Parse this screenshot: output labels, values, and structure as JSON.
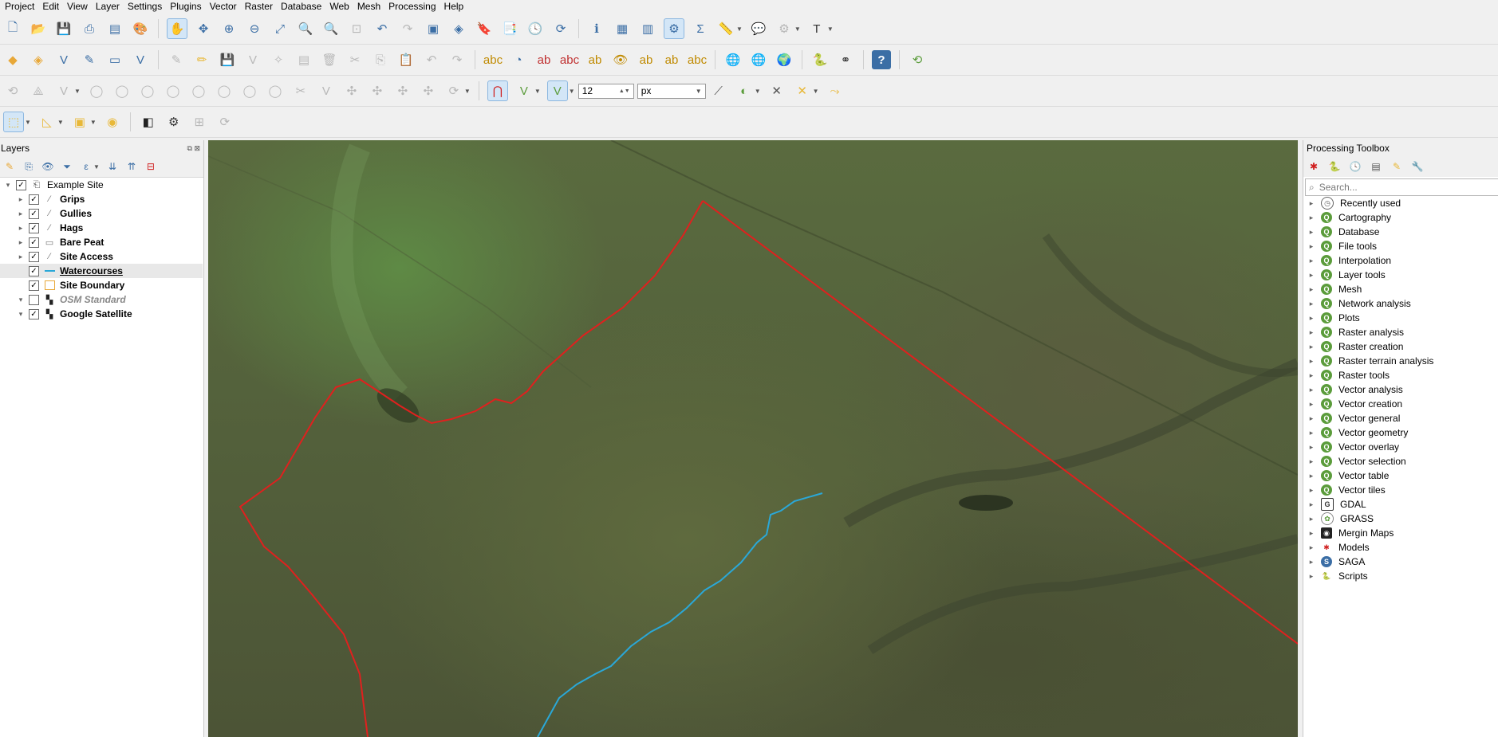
{
  "menubar": [
    "Project",
    "Edit",
    "View",
    "Layer",
    "Settings",
    "Plugins",
    "Vector",
    "Raster",
    "Database",
    "Web",
    "Mesh",
    "Processing",
    "Help"
  ],
  "digitizing": {
    "tolerance_value": "12",
    "tolerance_unit": "px"
  },
  "layers_panel": {
    "title": "Layers",
    "items": [
      {
        "name": "Example Site",
        "checked": true,
        "expander": "▾",
        "symbol": "group-icon",
        "style": "normal"
      },
      {
        "name": "Grips",
        "checked": true,
        "expander": "▸",
        "symbol": "line-layer-icon",
        "style": "bold"
      },
      {
        "name": "Gullies",
        "checked": true,
        "expander": "▸",
        "symbol": "line-layer-icon",
        "style": "bold"
      },
      {
        "name": "Hags",
        "checked": true,
        "expander": "▸",
        "symbol": "line-layer-icon",
        "style": "bold"
      },
      {
        "name": "Bare Peat",
        "checked": true,
        "expander": "▸",
        "symbol": "polygon-layer-icon",
        "style": "bold"
      },
      {
        "name": "Site Access",
        "checked": true,
        "expander": "▸",
        "symbol": "line-layer-icon",
        "style": "bold"
      },
      {
        "name": "Watercourses",
        "checked": true,
        "expander": "",
        "symbol": "blue-line-icon",
        "style": "underline"
      },
      {
        "name": "Site Boundary",
        "checked": true,
        "expander": "",
        "symbol": "polygon-outline-icon",
        "style": "bold"
      },
      {
        "name": "OSM Standard",
        "checked": false,
        "expander": "▾",
        "symbol": "raster-layer-icon",
        "style": "italic"
      },
      {
        "name": "Google Satellite",
        "checked": true,
        "expander": "▾",
        "symbol": "raster-layer-icon",
        "style": "bold"
      }
    ]
  },
  "toolbox": {
    "title": "Processing Toolbox",
    "search_placeholder": "Search...",
    "items": [
      {
        "label": "Recently used",
        "icon": "clock-icon"
      },
      {
        "label": "Cartography",
        "icon": "qgis-icon"
      },
      {
        "label": "Database",
        "icon": "qgis-icon"
      },
      {
        "label": "File tools",
        "icon": "qgis-icon"
      },
      {
        "label": "Interpolation",
        "icon": "qgis-icon"
      },
      {
        "label": "Layer tools",
        "icon": "qgis-icon"
      },
      {
        "label": "Mesh",
        "icon": "qgis-icon"
      },
      {
        "label": "Network analysis",
        "icon": "qgis-icon"
      },
      {
        "label": "Plots",
        "icon": "qgis-icon"
      },
      {
        "label": "Raster analysis",
        "icon": "qgis-icon"
      },
      {
        "label": "Raster creation",
        "icon": "qgis-icon"
      },
      {
        "label": "Raster terrain analysis",
        "icon": "qgis-icon"
      },
      {
        "label": "Raster tools",
        "icon": "qgis-icon"
      },
      {
        "label": "Vector analysis",
        "icon": "qgis-icon"
      },
      {
        "label": "Vector creation",
        "icon": "qgis-icon"
      },
      {
        "label": "Vector general",
        "icon": "qgis-icon"
      },
      {
        "label": "Vector geometry",
        "icon": "qgis-icon"
      },
      {
        "label": "Vector overlay",
        "icon": "qgis-icon"
      },
      {
        "label": "Vector selection",
        "icon": "qgis-icon"
      },
      {
        "label": "Vector table",
        "icon": "qgis-icon"
      },
      {
        "label": "Vector tiles",
        "icon": "qgis-icon"
      },
      {
        "label": "GDAL",
        "icon": "gdal-icon"
      },
      {
        "label": "GRASS",
        "icon": "grass-icon"
      },
      {
        "label": "Mergin Maps",
        "icon": "mergin-icon"
      },
      {
        "label": "Models",
        "icon": "models-icon"
      },
      {
        "label": "SAGA",
        "icon": "saga-icon"
      },
      {
        "label": "Scripts",
        "icon": "python-icon"
      }
    ]
  },
  "colors": {
    "boundary": "#e0201e",
    "watercourse": "#2aa8d8",
    "qgis_green": "#5b9c3b"
  }
}
